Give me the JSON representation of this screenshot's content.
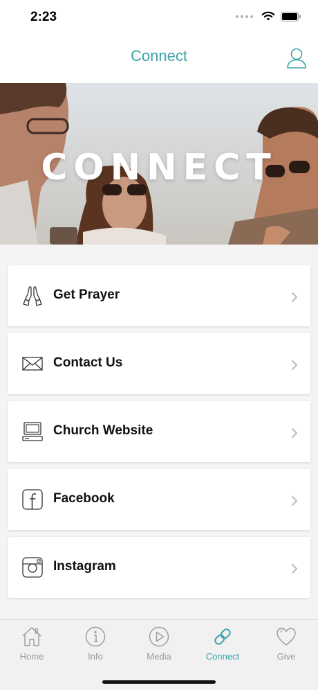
{
  "status_bar": {
    "time": "2:23"
  },
  "header": {
    "title": "Connect",
    "profile_icon": "user-icon"
  },
  "hero": {
    "text": "CONNECT"
  },
  "menu": [
    {
      "label": "Get Prayer",
      "icon": "praying-hands-icon"
    },
    {
      "label": "Contact Us",
      "icon": "envelope-icon"
    },
    {
      "label": "Church Website",
      "icon": "computer-icon"
    },
    {
      "label": "Facebook",
      "icon": "facebook-icon"
    },
    {
      "label": "Instagram",
      "icon": "instagram-icon"
    }
  ],
  "tabs": [
    {
      "label": "Home",
      "icon": "home-icon",
      "active": false
    },
    {
      "label": "Info",
      "icon": "info-icon",
      "active": false
    },
    {
      "label": "Media",
      "icon": "play-icon",
      "active": false
    },
    {
      "label": "Connect",
      "icon": "link-icon",
      "active": true
    },
    {
      "label": "Give",
      "icon": "heart-icon",
      "active": false
    }
  ],
  "colors": {
    "accent": "#3aa3a8",
    "inactive": "#999999",
    "background": "#f4f4f4"
  }
}
